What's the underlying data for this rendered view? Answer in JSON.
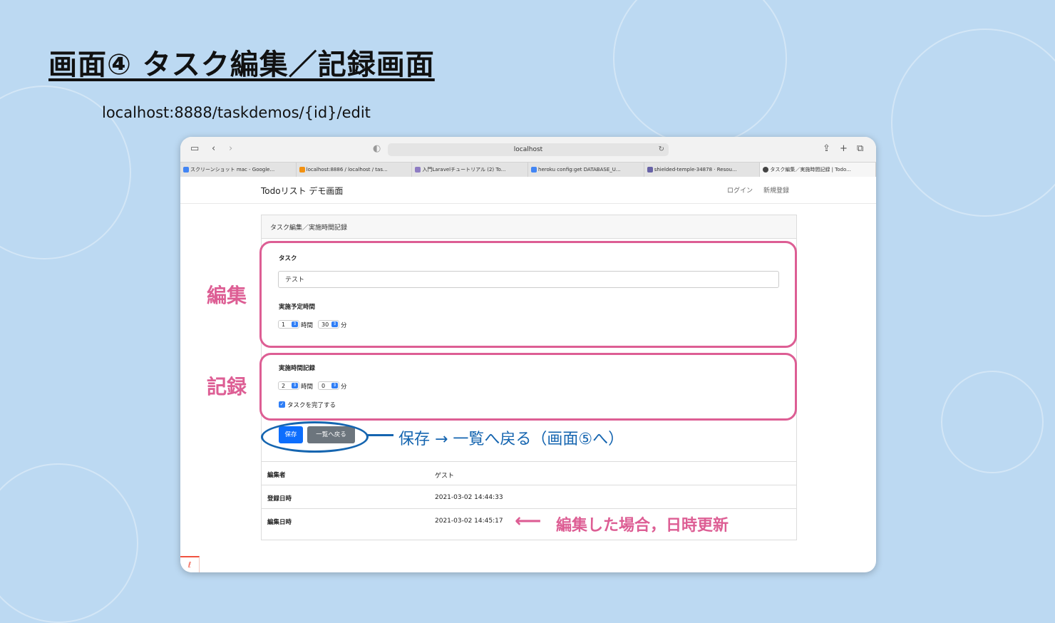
{
  "slide": {
    "title": "画面④ タスク編集／記録画面",
    "url_caption": "localhost:8888/taskdemos/{id}/edit"
  },
  "browser": {
    "address": "localhost",
    "tabs": [
      {
        "label": "スクリーンショット mac - Google...",
        "favicon": "google-icon",
        "color": "#4285f4"
      },
      {
        "label": "localhost:8886 / localhost / tas...",
        "favicon": "phpmyadmin-icon",
        "color": "#f29111"
      },
      {
        "label": "入門Laravelチュートリアル (2) To...",
        "favicon": "qiita-icon",
        "color": "#8e7cc3"
      },
      {
        "label": "heroku config:get DATABASE_U...",
        "favicon": "google-icon",
        "color": "#4285f4"
      },
      {
        "label": "shielded-temple-34878 · Resou...",
        "favicon": "heroku-icon",
        "color": "#6762a6"
      },
      {
        "label": "タスク編集／実施時間記録 | Todo...",
        "favicon": "github-icon",
        "color": "#444444",
        "active": true
      }
    ]
  },
  "navbar": {
    "brand": "Todoリスト デモ画面",
    "login": "ログイン",
    "register": "新規登録"
  },
  "card": {
    "header": "タスク編集／実施時間記録",
    "task_label": "タスク",
    "task_value": "テスト",
    "planned_label": "実施予定時間",
    "planned_hours": "1",
    "planned_minutes": "30",
    "hours_unit": "時間",
    "minutes_unit": "分",
    "record_label": "実施時間記録",
    "record_hours": "2",
    "record_minutes": "0",
    "complete_label": "タスクを完了する",
    "complete_checked": true,
    "save_button": "保存",
    "back_button": "一覧へ戻る",
    "table": [
      {
        "key": "編集者",
        "value": "ゲスト"
      },
      {
        "key": "登録日時",
        "value": "2021-03-02 14:44:33"
      },
      {
        "key": "編集日時",
        "value": "2021-03-02 14:45:17"
      }
    ]
  },
  "annotations": {
    "edit": "編集",
    "record": "記録",
    "save_note": "保存 → 一覧へ戻る（画面⑤へ）",
    "update_note": "編集した場合，日時更新",
    "pink_color": "#dd5e94",
    "blue_color": "#1565b0"
  }
}
